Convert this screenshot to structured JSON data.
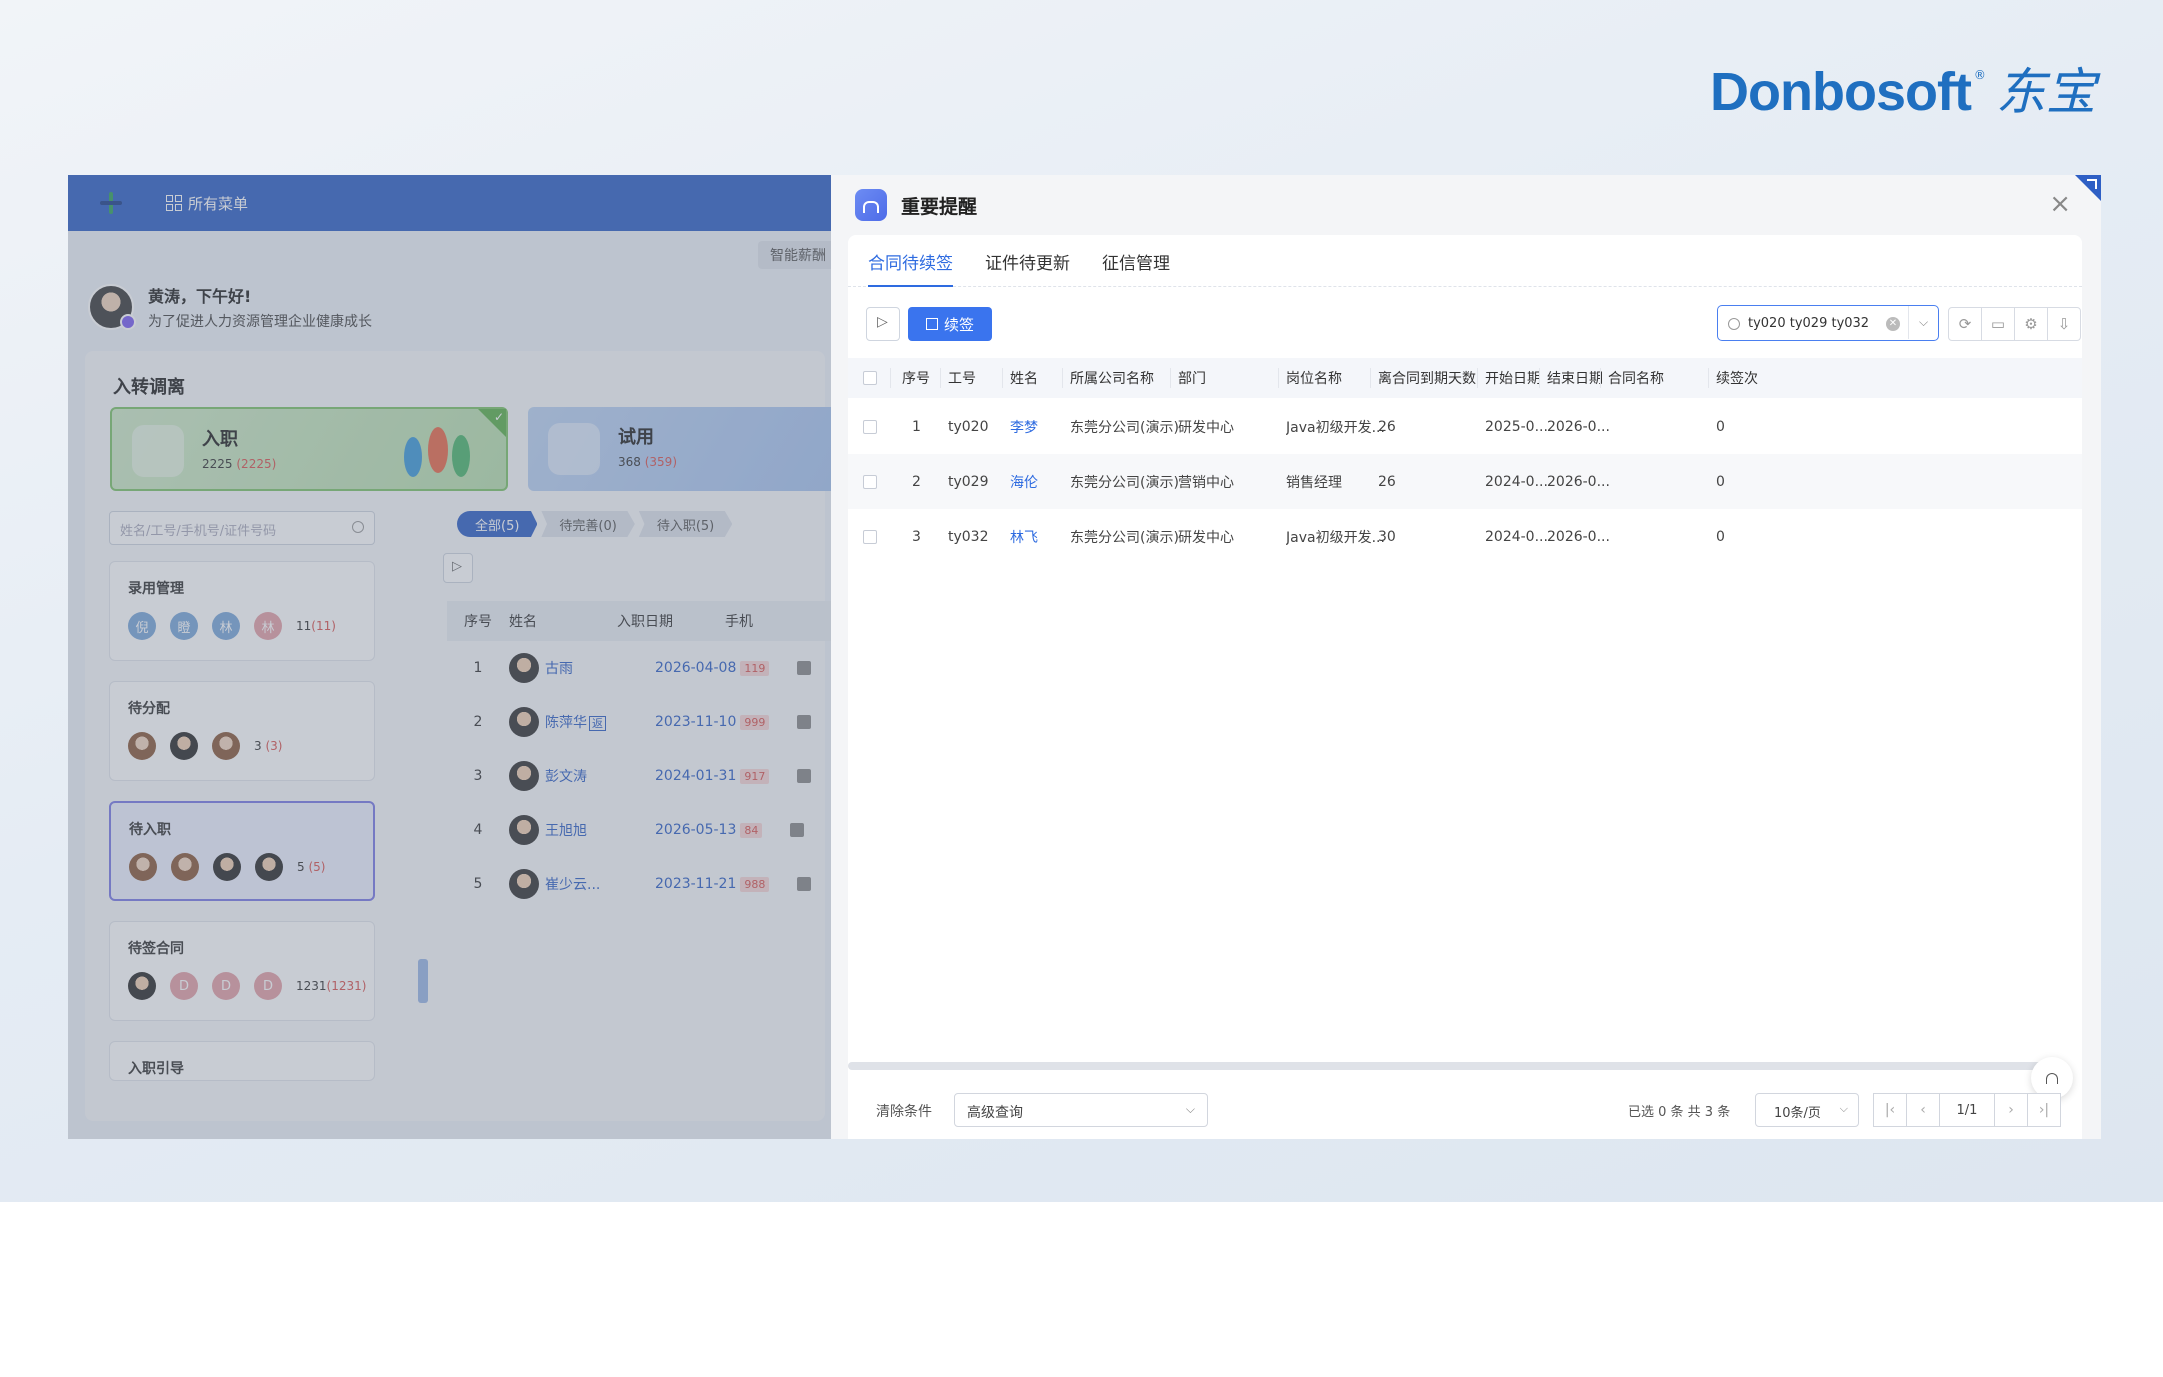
{
  "brand": {
    "wordmark": "Donbosoft",
    "reg": "®",
    "chinese": "东宝"
  },
  "topbar": {
    "menu_label": "所有菜单"
  },
  "background": {
    "ai_pill": "智能薪酬",
    "greeting": {
      "title": "黄涛，下午好!",
      "subtitle": "为了促进人力资源管理企业健康成长"
    },
    "panel_title": "入转调离",
    "card_ruzhi": {
      "name": "入职",
      "count": "2225",
      "count_red": "(2225)"
    },
    "card_shiyong": {
      "name": "试用",
      "count": "368",
      "count_red": "(359)"
    },
    "search_placeholder": "姓名/工号/手机号/证件号码",
    "side_cards": [
      {
        "title": "录用管理",
        "chips": [
          "倪",
          "瞪",
          "林",
          "林"
        ],
        "count": "11",
        "count_red": "(11)"
      },
      {
        "title": "待分配",
        "count": "3",
        "count_red": "(3)"
      },
      {
        "title": "待入职",
        "count": "5",
        "count_red": "(5)"
      },
      {
        "title": "待签合同",
        "chips": [
          "D",
          "D",
          "D"
        ],
        "count": "1231",
        "count_red": "(1231)"
      },
      {
        "title": "入职引导"
      }
    ],
    "pill_tabs": [
      "全部(5)",
      "待完善(0)",
      "待入职(5)"
    ],
    "list_headers": [
      "序号",
      "姓名",
      "入职日期",
      "手机"
    ],
    "list_rows": [
      {
        "idx": "1",
        "name": "古雨",
        "date": "2026-04-08",
        "tag": "119"
      },
      {
        "idx": "2",
        "name": "陈萍华",
        "badge": "返",
        "date": "2023-11-10",
        "tag": "999"
      },
      {
        "idx": "3",
        "name": "彭文涛",
        "date": "2024-01-31",
        "tag": "917"
      },
      {
        "idx": "4",
        "name": "王旭旭",
        "date": "2026-05-13",
        "tag": "84"
      },
      {
        "idx": "5",
        "name": "崔少云...",
        "date": "2023-11-21",
        "tag": "988"
      }
    ]
  },
  "modal": {
    "title": "重要提醒",
    "close": "×",
    "tabs": [
      "合同待续签",
      "证件待更新",
      "征信管理"
    ],
    "renew_label": "续签",
    "search_value": "ty020 ty029 ty032",
    "clear_icon": "✕",
    "dropdown_icon": "⌵",
    "toolbar_icons": [
      "refresh-icon",
      "export-icon",
      "settings-icon",
      "download-icon"
    ],
    "columns": [
      "序号",
      "工号",
      "姓名",
      "所属公司名称",
      "部门",
      "岗位名称",
      "离合同到期天数",
      "开始日期",
      "结束日期",
      "合同名称",
      "续签次"
    ],
    "rows": [
      {
        "idx": "1",
        "code": "ty020",
        "name": "李梦",
        "company": "东莞分公司(演示)",
        "dept": "研发中心",
        "post": "Java初级开发...",
        "days": "26",
        "start": "2025-0...",
        "end": "2026-0...",
        "contract": "",
        "times": "0"
      },
      {
        "idx": "2",
        "code": "ty029",
        "name": "海伦",
        "company": "东莞分公司(演示)",
        "dept": "营销中心",
        "post": "销售经理",
        "days": "26",
        "start": "2024-0...",
        "end": "2026-0...",
        "contract": "",
        "times": "0"
      },
      {
        "idx": "3",
        "code": "ty032",
        "name": "林飞",
        "company": "东莞分公司(演示)",
        "dept": "研发中心",
        "post": "Java初级开发...",
        "days": "30",
        "start": "2024-0...",
        "end": "2026-0...",
        "contract": "",
        "times": "0"
      }
    ],
    "footer": {
      "clear": "清除条件",
      "advanced": "高级查询",
      "selected_info": "已选 0 条   共 3 条",
      "page_size": "10条/页",
      "page": "1/1"
    }
  },
  "colors": {
    "primary": "#2e5fc5",
    "accent": "#3a74ee",
    "link": "#2e6be0",
    "alert_red": "#d9534f"
  }
}
